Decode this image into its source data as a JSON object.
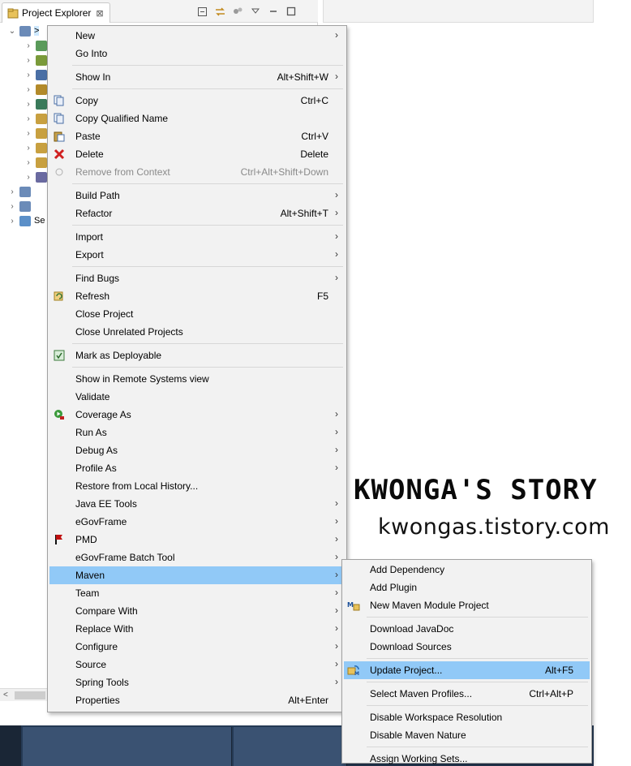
{
  "view": {
    "tab_title": "Project Explorer",
    "close_glyph": "⊠",
    "toolbar_icons": [
      "collapse-all-icon",
      "link-with-editor-icon",
      "filters-icon",
      "view-menu-icon",
      "minimize-icon",
      "maximize-icon"
    ],
    "tree": [
      {
        "expanded": true,
        "label": ">",
        "selected": true
      },
      {
        "expanded": false,
        "label": ""
      },
      {
        "expanded": false,
        "label": ""
      },
      {
        "expanded": false,
        "label": ""
      },
      {
        "expanded": false,
        "label": ""
      },
      {
        "expanded": false,
        "label": ""
      },
      {
        "expanded": false,
        "label": ""
      },
      {
        "expanded": false,
        "label": ""
      },
      {
        "expanded": false,
        "label": ""
      },
      {
        "expanded": false,
        "label": ""
      },
      {
        "expanded": false,
        "label": ""
      },
      {
        "expanded": false,
        "label": ""
      },
      {
        "expanded": false,
        "label": ""
      },
      {
        "expanded": false,
        "label": "Se"
      }
    ]
  },
  "context_menu": {
    "items": [
      {
        "label": "New",
        "shortcut": "",
        "submenu": true
      },
      {
        "label": "Go Into",
        "shortcut": "",
        "submenu": false
      },
      {
        "label": "Show In",
        "shortcut": "Alt+Shift+W",
        "submenu": true
      },
      {
        "label": "Copy",
        "shortcut": "Ctrl+C",
        "submenu": false
      },
      {
        "label": "Copy Qualified Name",
        "shortcut": "",
        "submenu": false
      },
      {
        "label": "Paste",
        "shortcut": "Ctrl+V",
        "submenu": false
      },
      {
        "label": "Delete",
        "shortcut": "Delete",
        "submenu": false
      },
      {
        "label": "Remove from Context",
        "shortcut": "Ctrl+Alt+Shift+Down",
        "submenu": false,
        "disabled": true
      },
      {
        "label": "Build Path",
        "shortcut": "",
        "submenu": true
      },
      {
        "label": "Refactor",
        "shortcut": "Alt+Shift+T",
        "submenu": true
      },
      {
        "label": "Import",
        "shortcut": "",
        "submenu": true
      },
      {
        "label": "Export",
        "shortcut": "",
        "submenu": true
      },
      {
        "label": "Find Bugs",
        "shortcut": "",
        "submenu": true
      },
      {
        "label": "Refresh",
        "shortcut": "F5",
        "submenu": false
      },
      {
        "label": "Close Project",
        "shortcut": "",
        "submenu": false
      },
      {
        "label": "Close Unrelated Projects",
        "shortcut": "",
        "submenu": false
      },
      {
        "label": "Mark as Deployable",
        "shortcut": "",
        "submenu": false
      },
      {
        "label": "Show in Remote Systems view",
        "shortcut": "",
        "submenu": false
      },
      {
        "label": "Validate",
        "shortcut": "",
        "submenu": false
      },
      {
        "label": "Coverage As",
        "shortcut": "",
        "submenu": true
      },
      {
        "label": "Run As",
        "shortcut": "",
        "submenu": true
      },
      {
        "label": "Debug As",
        "shortcut": "",
        "submenu": true
      },
      {
        "label": "Profile As",
        "shortcut": "",
        "submenu": true
      },
      {
        "label": "Restore from Local History...",
        "shortcut": "",
        "submenu": false
      },
      {
        "label": "Java EE Tools",
        "shortcut": "",
        "submenu": true
      },
      {
        "label": "eGovFrame",
        "shortcut": "",
        "submenu": true
      },
      {
        "label": "PMD",
        "shortcut": "",
        "submenu": true
      },
      {
        "label": "eGovFrame Batch Tool",
        "shortcut": "",
        "submenu": true
      },
      {
        "label": "Maven",
        "shortcut": "",
        "submenu": true,
        "highlighted": true
      },
      {
        "label": "Team",
        "shortcut": "",
        "submenu": true
      },
      {
        "label": "Compare With",
        "shortcut": "",
        "submenu": true
      },
      {
        "label": "Replace With",
        "shortcut": "",
        "submenu": true
      },
      {
        "label": "Configure",
        "shortcut": "",
        "submenu": true
      },
      {
        "label": "Source",
        "shortcut": "",
        "submenu": true
      },
      {
        "label": "Spring Tools",
        "shortcut": "",
        "submenu": true
      },
      {
        "label": "Properties",
        "shortcut": "Alt+Enter",
        "submenu": false
      }
    ]
  },
  "maven_submenu": {
    "items": [
      {
        "label": "Add Dependency",
        "shortcut": ""
      },
      {
        "label": "Add Plugin",
        "shortcut": ""
      },
      {
        "label": "New Maven Module Project",
        "shortcut": ""
      },
      {
        "label": "Download JavaDoc",
        "shortcut": ""
      },
      {
        "label": "Download Sources",
        "shortcut": ""
      },
      {
        "label": "Update Project...",
        "shortcut": "Alt+F5",
        "highlighted": true
      },
      {
        "label": "Select Maven Profiles...",
        "shortcut": "Ctrl+Alt+P"
      },
      {
        "label": "Disable Workspace Resolution",
        "shortcut": ""
      },
      {
        "label": "Disable Maven Nature",
        "shortcut": ""
      },
      {
        "label": "Assign Working Sets...",
        "shortcut": ""
      }
    ]
  },
  "watermark": {
    "title": "KWONGA'S STORY",
    "url": "kwongas.tistory.com"
  },
  "colors": {
    "menu_bg": "#f2f2f2",
    "highlight": "#91c9f7",
    "taskbar": "#253a55"
  }
}
